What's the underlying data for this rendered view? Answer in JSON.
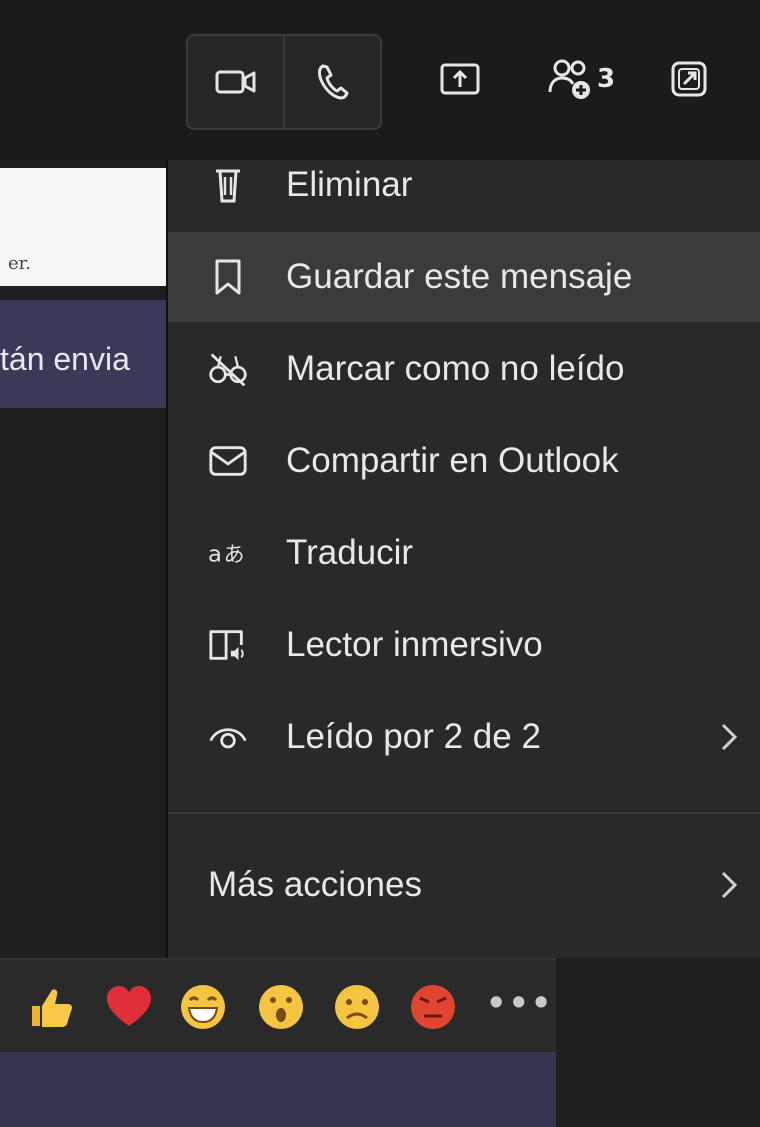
{
  "toolbar": {
    "video_call_icon": "video-camera-icon",
    "audio_call_icon": "phone-icon",
    "share_icon": "share-screen-icon",
    "participants_icon": "people-add-icon",
    "participants_count": "3",
    "popout_icon": "pop-out-icon"
  },
  "background": {
    "white_snippet": "er.",
    "purple_snippet": "tán envia"
  },
  "menu": {
    "items": [
      {
        "label": "Eliminar",
        "icon": "trash-icon"
      },
      {
        "label": "Guardar este mensaje",
        "icon": "bookmark-icon",
        "highlighted": true
      },
      {
        "label": "Marcar como no leído",
        "icon": "unread-glasses-icon"
      },
      {
        "label": "Compartir en Outlook",
        "icon": "mail-icon"
      },
      {
        "label": "Traducir",
        "icon": "translate-icon"
      },
      {
        "label": "Lector inmersivo",
        "icon": "immersive-reader-icon"
      },
      {
        "label": "Leído por 2 de 2",
        "icon": "eye-icon",
        "has_submenu": true
      }
    ],
    "more_actions": {
      "label": "Más acciones",
      "has_submenu": true
    }
  },
  "reactions": {
    "items": [
      "like-emoji",
      "heart-emoji",
      "laugh-emoji",
      "surprised-emoji",
      "sad-emoji",
      "angry-emoji"
    ],
    "more": "•••"
  },
  "colors": {
    "menu_bg": "#292929",
    "highlight_bg": "#3b3b3b",
    "text": "#e8e8e8",
    "purple": "#3a3a58"
  }
}
